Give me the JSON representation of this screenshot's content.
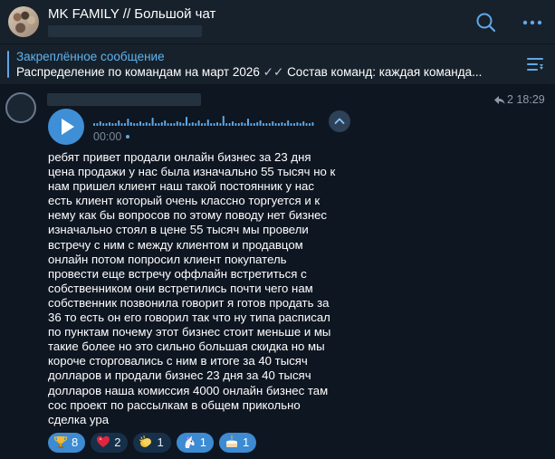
{
  "header": {
    "title": "MK FAMILY // Большой чат",
    "search_icon": "search-icon",
    "more_icon": "more-vertical-icon"
  },
  "pinned": {
    "title": "Закреплённое сообщение",
    "text_first": "Распределение по командам на март 2026",
    "check_mark": "✓✓",
    "text_second": "Состав команд: каждая команда..."
  },
  "message": {
    "forward_count": "2",
    "time": "18:29",
    "voice_duration": "00:00",
    "text": "ребят привет продали онлайн бизнес за 23 дня\nцена продажи у нас была изначально 55 тысяч но к\nнам пришел клиент наш такой постоянник у нас\nесть клиент который очень классно торгуется и к\nнему как бы вопросов по этому поводу нет бизнес\nизначально стоял в цене 55 тысяч мы провели\nвстречу с ним с между клиентом и продавцом\nонлайн потом попросил клиент покупатель\nпровести еще встречу оффлайн встретиться с\nсобственником они встретились почти чего нам\nсобственник позвонила говорит я готов продать за\n36 то есть он его говорил так что ну типа расписал\nпо пунктам почему этот бизнес стоит меньше и мы\nтакие более но это сильно большая скидка но мы\nкороче сторговались с ним в итоге за 40 тысяч\nдолларов и продали бизнес 23 дня за 40 тысяч\nдолларов наша комиссия 4000 онлайн бизнес там\nсос проект по рассылкам в общем прикольно\nсделка ура"
  },
  "reactions": [
    {
      "icon": "trophy-icon",
      "count": "8",
      "selected": true
    },
    {
      "icon": "red-heart-icon",
      "count": "2",
      "selected": false
    },
    {
      "icon": "clap-icon",
      "count": "1",
      "selected": false
    },
    {
      "icon": "unicorn-icon",
      "count": "1",
      "selected": true
    },
    {
      "icon": "cake-icon",
      "count": "1",
      "selected": true
    }
  ],
  "colors": {
    "accent": "#3e8fd6",
    "link": "#5fb4f0",
    "background": "#0e1621",
    "header": "#17212b"
  }
}
